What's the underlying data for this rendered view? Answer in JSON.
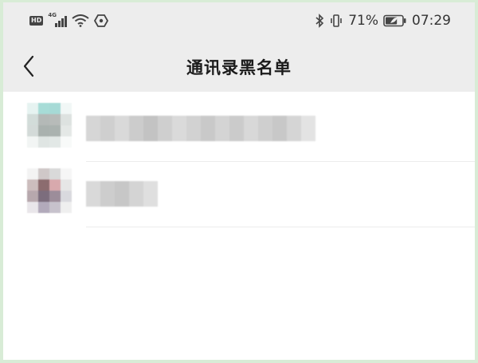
{
  "status_bar": {
    "hd": "HD",
    "network": "4G",
    "battery_percent": "71%",
    "battery_level": 0.71,
    "time": "07:29"
  },
  "header": {
    "title": "通讯录黑名单"
  },
  "blacklist": [
    {
      "avatar_colors": [
        "#e6f3f1",
        "#a7dcd7",
        "#a6dad6",
        "#f1f7f6",
        "#d2dcd9",
        "#b4b9b7",
        "#b7bbb9",
        "#dde2e0",
        "#d3dad8",
        "#a9b1ae",
        "#aab2af",
        "#e4e8e6",
        "#f2f5f4",
        "#dfe5e3",
        "#e2e8e6",
        "#f8faf9"
      ],
      "name_colors": [
        "#d6d6d6",
        "#cfcfcf",
        "#d9d9d9",
        "#cccccc",
        "#c3c3c3",
        "#cfcfcf",
        "#dadada",
        "#d2d2d2",
        "#c9c9c9",
        "#d4d4d4",
        "#cbcbcb",
        "#d8d8d8",
        "#cfcfcf",
        "#c8c8c8",
        "#d5d5d5",
        "#e3e3e3"
      ]
    },
    {
      "avatar_colors": [
        "#f3f3f3",
        "#cfc8c8",
        "#d9d9d9",
        "#f6f6f6",
        "#ccbdbd",
        "#8c6c6f",
        "#d8a9ad",
        "#e6e6e6",
        "#b7a8ad",
        "#7c6d7d",
        "#9c8d9a",
        "#d9d9de",
        "#e9e6ea",
        "#b2aabb",
        "#c7c2cc",
        "#efefef"
      ],
      "name_colors": [
        "#d9d9d9",
        "#cdcdcd",
        "#c7c7c7",
        "#d4d4d4",
        "#dfdfdf"
      ]
    }
  ]
}
